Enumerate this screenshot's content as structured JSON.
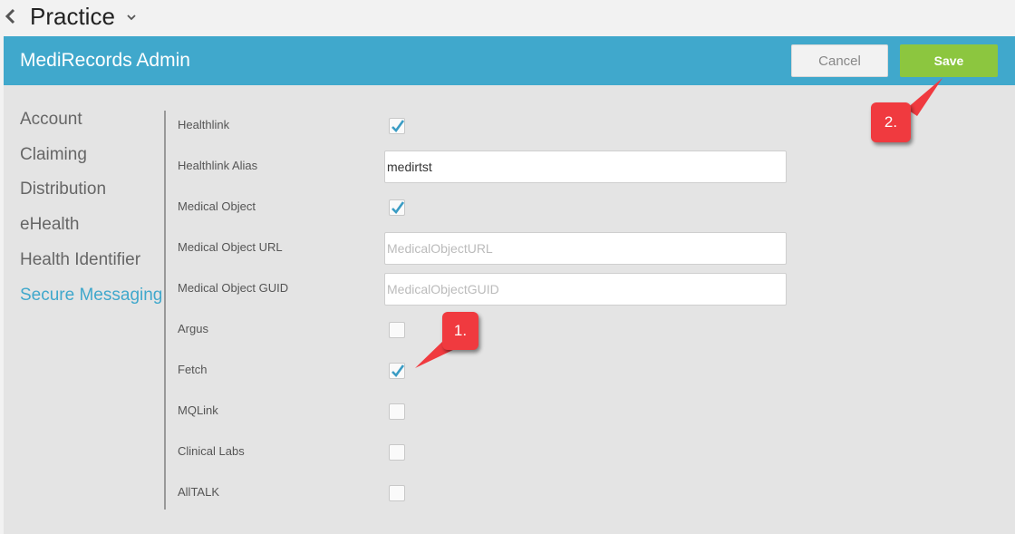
{
  "topbar": {
    "title": "Practice",
    "back_icon": "chevron-left-icon",
    "menu_icon": "chevron-down-icon"
  },
  "header": {
    "title": "MediRecords Admin",
    "cancel_label": "Cancel",
    "save_label": "Save",
    "bg_color": "#40a8cc",
    "save_color": "#8cc63f"
  },
  "sidebar": {
    "items": [
      {
        "label": "Account"
      },
      {
        "label": "Claiming"
      },
      {
        "label": "Distribution"
      },
      {
        "label": "eHealth"
      },
      {
        "label": "Health Identifier"
      },
      {
        "label": "Secure Messaging",
        "active": true
      }
    ]
  },
  "form": {
    "healthlink": {
      "label": "Healthlink",
      "checked": true
    },
    "healthlink_alias": {
      "label": "Healthlink Alias",
      "value": "medirtst"
    },
    "medical_object": {
      "label": "Medical Object",
      "checked": true
    },
    "medical_object_url": {
      "label": "Medical Object URL",
      "placeholder": "MedicalObjectURL"
    },
    "medical_object_guid": {
      "label": "Medical Object GUID",
      "placeholder": "MedicalObjectGUID"
    },
    "argus": {
      "label": "Argus",
      "checked": false
    },
    "fetch": {
      "label": "Fetch",
      "checked": true
    },
    "mqlink": {
      "label": "MQLink",
      "checked": false
    },
    "clinical_labs": {
      "label": "Clinical Labs",
      "checked": false
    },
    "alltalk": {
      "label": "AllTALK",
      "checked": false
    }
  },
  "annotations": {
    "callout_1": "1.",
    "callout_2": "2.",
    "color": "#f03a3f"
  }
}
